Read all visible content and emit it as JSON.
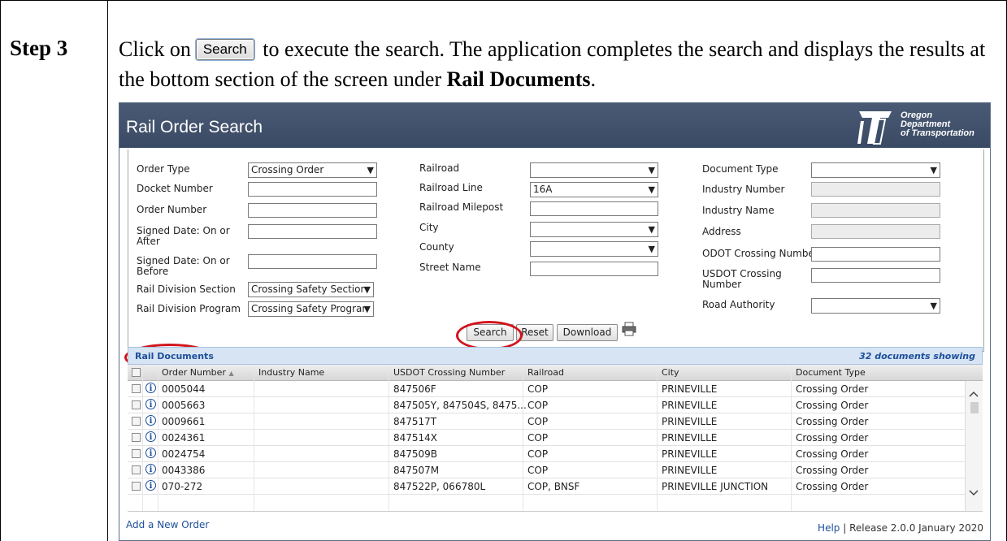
{
  "step": {
    "label": "Step 3",
    "instruction_before": "Click on",
    "inline_button": "Search",
    "instruction_after": " to execute the search. The application completes the search and displays the results at the bottom section of the screen under ",
    "instruction_bold": "Rail Documents",
    "instruction_end": "."
  },
  "app": {
    "title": "Rail Order Search",
    "logo_lines": [
      "Oregon",
      "Department",
      "of Transportation"
    ],
    "colors": {
      "header": "#3e4e69",
      "accent_red": "#d3141c",
      "link": "#1d4f9a",
      "results_bar": "#d6e4f4"
    }
  },
  "form": {
    "col1": {
      "order_type_label": "Order Type",
      "order_type_value": "Crossing Order",
      "docket_number_label": "Docket Number",
      "order_number_label": "Order Number",
      "signed_after_label": "Signed Date: On or After",
      "signed_before_label": "Signed Date: On or Before",
      "rail_division_section_label": "Rail Division Section",
      "rail_division_section_value": "Crossing Safety Section",
      "rail_division_program_label": "Rail Division Program",
      "rail_division_program_value": "Crossing Safety Program"
    },
    "col2": {
      "railroad_label": "Railroad",
      "railroad_line_label": "Railroad Line",
      "railroad_line_value": "16A",
      "railroad_milepost_label": "Railroad Milepost",
      "city_label": "City",
      "county_label": "County",
      "street_name_label": "Street Name"
    },
    "col3": {
      "document_type_label": "Document Type",
      "industry_number_label": "Industry Number",
      "industry_name_label": "Industry Name",
      "address_label": "Address",
      "odot_crossing_label": "ODOT Crossing Number",
      "usdot_crossing_label": "USDOT Crossing Number",
      "road_authority_label": "Road Authority"
    },
    "buttons": {
      "search": "Search",
      "reset": "Reset",
      "download": "Download"
    },
    "icons": {
      "print": "printer-icon",
      "chevron": "▼"
    }
  },
  "results": {
    "title": "Rail Documents",
    "count": "32 documents showing",
    "columns": [
      "Order Number",
      "Industry Name",
      "USDOT Crossing Number",
      "Railroad",
      "City",
      "Document Type"
    ],
    "sort_indicator": "▲",
    "rows": [
      [
        "0005044",
        "",
        "847506F",
        "COP",
        "PRINEVILLE",
        "Crossing Order"
      ],
      [
        "0005663",
        "",
        "847505Y, 847504S, 8475...",
        "COP",
        "PRINEVILLE",
        "Crossing Order"
      ],
      [
        "0009661",
        "",
        "847517T",
        "COP",
        "PRINEVILLE",
        "Crossing Order"
      ],
      [
        "0024361",
        "",
        "847514X",
        "COP",
        "PRINEVILLE",
        "Crossing Order"
      ],
      [
        "0024754",
        "",
        "847509B",
        "COP",
        "PRINEVILLE",
        "Crossing Order"
      ],
      [
        "0043386",
        "",
        "847507M",
        "COP",
        "PRINEVILLE",
        "Crossing Order"
      ],
      [
        "070-272",
        "",
        "847522P, 066780L",
        "COP, BNSF",
        "PRINEVILLE JUNCTION",
        "Crossing Order"
      ]
    ]
  },
  "footer": {
    "add_order": "Add a New Order",
    "help": "Help",
    "release": "| Release 2.0.0 January 2020"
  }
}
